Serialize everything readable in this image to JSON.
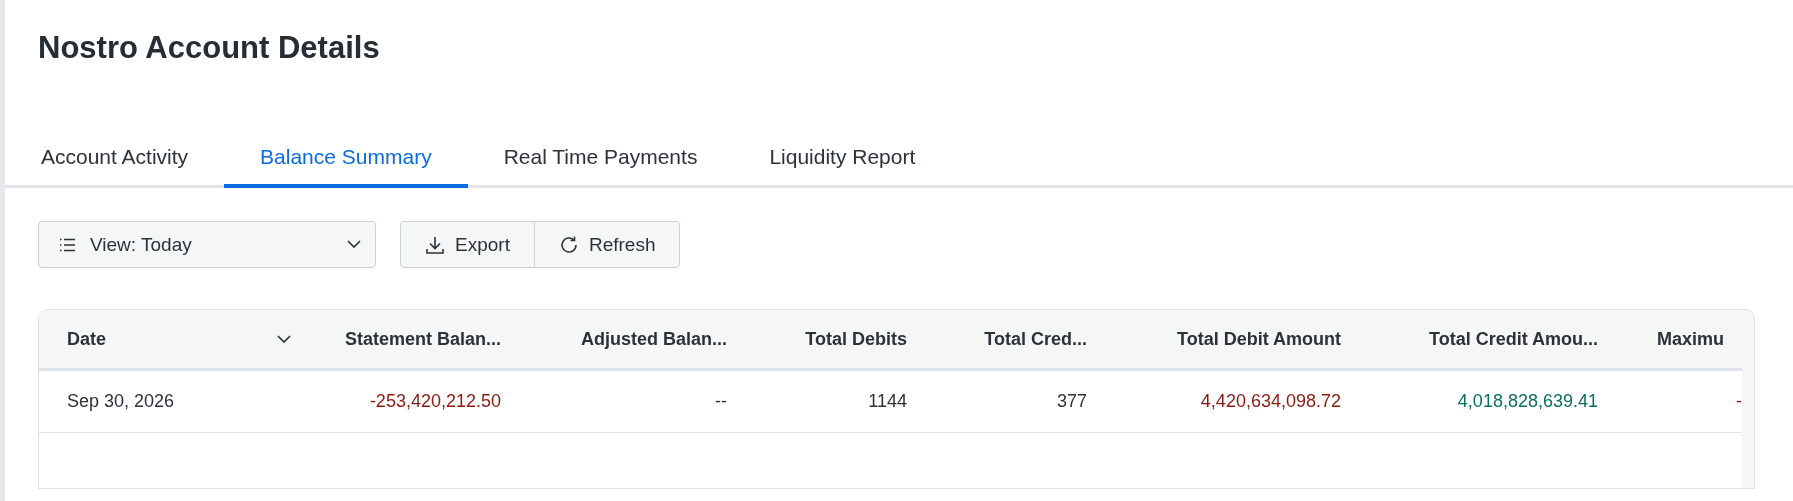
{
  "page": {
    "title": "Nostro Account Details"
  },
  "tabs": [
    {
      "label": "Account Activity",
      "selected": false
    },
    {
      "label": "Balance Summary",
      "selected": true
    },
    {
      "label": "Real Time Payments",
      "selected": false
    },
    {
      "label": "Liquidity Report",
      "selected": false
    }
  ],
  "toolbar": {
    "view_select": {
      "value": "View: Today"
    },
    "buttons": [
      {
        "kind": "export",
        "label": "Export"
      },
      {
        "kind": "refresh",
        "label": "Refresh"
      }
    ]
  },
  "table": {
    "columns": [
      {
        "label": "Date",
        "sortable": true
      },
      {
        "label": "Statement Balan..."
      },
      {
        "label": "Adjusted Balan..."
      },
      {
        "label": "Total Debits"
      },
      {
        "label": "Total Cred..."
      },
      {
        "label": "Total Debit Amount"
      },
      {
        "label": "Total Credit Amou..."
      },
      {
        "label": "Maximu"
      }
    ],
    "rows": [
      {
        "cells": [
          {
            "text": "Sep 30, 2026",
            "kind": "neutral"
          },
          {
            "text": "-253,420,212.50",
            "kind": "negative"
          },
          {
            "text": "--",
            "kind": "neutral"
          },
          {
            "text": "1144",
            "kind": "neutral"
          },
          {
            "text": "377",
            "kind": "neutral"
          },
          {
            "text": "4,420,634,098.72",
            "kind": "negative"
          },
          {
            "text": "4,018,828,639.41",
            "kind": "positive"
          },
          {
            "text": "-",
            "kind": "negative"
          }
        ]
      }
    ]
  }
}
